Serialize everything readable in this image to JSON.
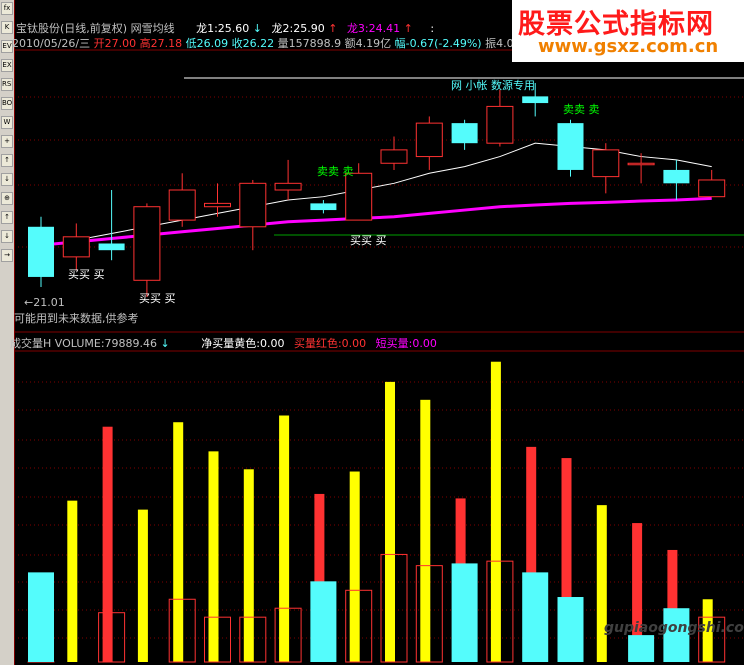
{
  "toolbar": {
    "buttons": [
      "fx",
      "K",
      "EV",
      "EX",
      "RSI",
      "BO",
      "W",
      "+",
      "↑",
      "↓",
      "⊕",
      "↑",
      "↓",
      "→"
    ]
  },
  "header": {
    "stock_name": "宝钛股份(日线,前复权)",
    "indicator_name": "网雪均线",
    "long1": "龙1:25.60",
    "long1_arrow": "↓",
    "long2": "龙2:25.90",
    "long2_arrow": "↑",
    "long3": "龙3:24.41",
    "long3_arrow": "↑",
    "colon": ":",
    "date": "2010/05/26/三",
    "open": "开27.00",
    "high": "高27.18",
    "low": "低26.09",
    "close": "收26.22",
    "volume": "量157898.9",
    "amount": "额4.19亿",
    "change": "幅-0.67(-2.49%)",
    "amplitude": "振4.0"
  },
  "price_panel": {
    "label_top": "网 小帐 数源专用",
    "signal_sell1": "卖卖 卖",
    "signal_sell2": "卖卖 卖",
    "signal_buy1": "买买 买",
    "signal_buy2": "买买 买",
    "signal_buy3": "买买 买",
    "low_marker": "←21.01",
    "warning": "可能用到未来数据,供参考"
  },
  "volume_panel": {
    "title": "成交量H",
    "volume_label": "VOLUME:79889.46",
    "arrow": "↓",
    "net_yellow": "净买量黄色:0.00",
    "buy_red": "买量红色:0.00",
    "short_buy": "短买量:0.00"
  },
  "ad": {
    "title": "股票公式指标网",
    "url": "www.gsxz.com.cn",
    "watermark": "gupiaogongshi.com"
  },
  "colors": {
    "up": "#ff3232",
    "down": "#54fcfc",
    "yellow": "#ffff00",
    "magenta": "#ff00ff",
    "white_line": "#ffffff",
    "grid": "#800000"
  },
  "chart_data": {
    "type": "candlestick",
    "candles": [
      {
        "o": 25.3,
        "c": 23.8,
        "h": 25.6,
        "l": 23.5
      },
      {
        "o": 24.4,
        "c": 25.0,
        "h": 25.4,
        "l": 24.0
      },
      {
        "o": 24.8,
        "c": 24.6,
        "h": 26.4,
        "l": 24.3
      },
      {
        "o": 23.7,
        "c": 25.9,
        "h": 26.0,
        "l": 23.2
      },
      {
        "o": 25.5,
        "c": 26.4,
        "h": 26.9,
        "l": 25.3
      },
      {
        "o": 25.9,
        "c": 26.0,
        "h": 26.6,
        "l": 25.6
      },
      {
        "o": 25.3,
        "c": 26.6,
        "h": 26.7,
        "l": 24.6
      },
      {
        "o": 26.4,
        "c": 26.6,
        "h": 27.3,
        "l": 26.1
      },
      {
        "o": 26.0,
        "c": 25.8,
        "h": 26.1,
        "l": 25.7
      },
      {
        "o": 25.5,
        "c": 26.9,
        "h": 27.2,
        "l": 25.5
      },
      {
        "o": 27.2,
        "c": 27.6,
        "h": 28.0,
        "l": 27.0
      },
      {
        "o": 27.4,
        "c": 28.4,
        "h": 28.6,
        "l": 27.0
      },
      {
        "o": 28.4,
        "c": 27.8,
        "h": 28.5,
        "l": 27.6
      },
      {
        "o": 27.8,
        "c": 28.9,
        "h": 29.4,
        "l": 27.7
      },
      {
        "o": 29.2,
        "c": 29.0,
        "h": 29.6,
        "l": 28.6
      },
      {
        "o": 28.4,
        "c": 27.0,
        "h": 28.5,
        "l": 26.8
      },
      {
        "o": 26.8,
        "c": 27.6,
        "h": 27.8,
        "l": 26.3
      },
      {
        "o": 27.2,
        "c": 27.2,
        "h": 27.5,
        "l": 26.6
      },
      {
        "o": 27.0,
        "c": 26.6,
        "h": 27.3,
        "l": 26.1
      },
      {
        "o": 26.2,
        "c": 26.7,
        "h": 27.0,
        "l": 26.2
      }
    ],
    "ma_white": [
      24.7,
      24.9,
      25.1,
      25.3,
      25.5,
      25.7,
      25.9,
      26.1,
      26.2,
      26.4,
      26.6,
      26.9,
      27.1,
      27.4,
      27.8,
      27.7,
      27.6,
      27.4,
      27.3,
      27.1
    ],
    "ma_magenta": [
      24.75,
      24.85,
      24.95,
      25.05,
      25.15,
      25.25,
      25.35,
      25.45,
      25.5,
      25.55,
      25.6,
      25.7,
      25.8,
      25.9,
      25.95,
      26.0,
      26.03,
      26.07,
      26.1,
      26.15
    ],
    "volume": [
      {
        "total": 28,
        "buy": 12,
        "short": 40000,
        "yellow": 0
      },
      {
        "total": 0,
        "buy": 0,
        "short": 0,
        "yellow": 72000
      },
      {
        "total": 105000,
        "buy": 22000,
        "short": 0,
        "yellow": 0
      },
      {
        "total": 0,
        "buy": 0,
        "short": 0,
        "yellow": 68000
      },
      {
        "total": 0,
        "buy": 28000,
        "short": 0,
        "yellow": 107000
      },
      {
        "total": 0,
        "buy": 20000,
        "short": 0,
        "yellow": 94000
      },
      {
        "total": 0,
        "buy": 20000,
        "short": 0,
        "yellow": 86000
      },
      {
        "total": 0,
        "buy": 24000,
        "short": 0,
        "yellow": 110000
      },
      {
        "total": 75000,
        "buy": 0,
        "short": 36000,
        "yellow": 0
      },
      {
        "total": 0,
        "buy": 32000,
        "short": 0,
        "yellow": 85000
      },
      {
        "total": 0,
        "buy": 48000,
        "short": 0,
        "yellow": 125000
      },
      {
        "total": 0,
        "buy": 43000,
        "short": 0,
        "yellow": 117000
      },
      {
        "total": 73000,
        "buy": 0,
        "short": 44000,
        "yellow": 0
      },
      {
        "total": 0,
        "buy": 45000,
        "short": 0,
        "yellow": 134000
      },
      {
        "total": 96000,
        "buy": 0,
        "short": 40000,
        "yellow": 0
      },
      {
        "total": 91000,
        "buy": 0,
        "short": 29000,
        "yellow": 0
      },
      {
        "total": 0,
        "buy": 0,
        "short": 0,
        "yellow": 70000
      },
      {
        "total": 62000,
        "buy": 0,
        "short": 12000,
        "yellow": 0
      },
      {
        "total": 50000,
        "buy": 0,
        "short": 24000,
        "yellow": 0
      },
      {
        "total": 0,
        "buy": 20000,
        "short": 0,
        "yellow": 28000
      }
    ]
  }
}
